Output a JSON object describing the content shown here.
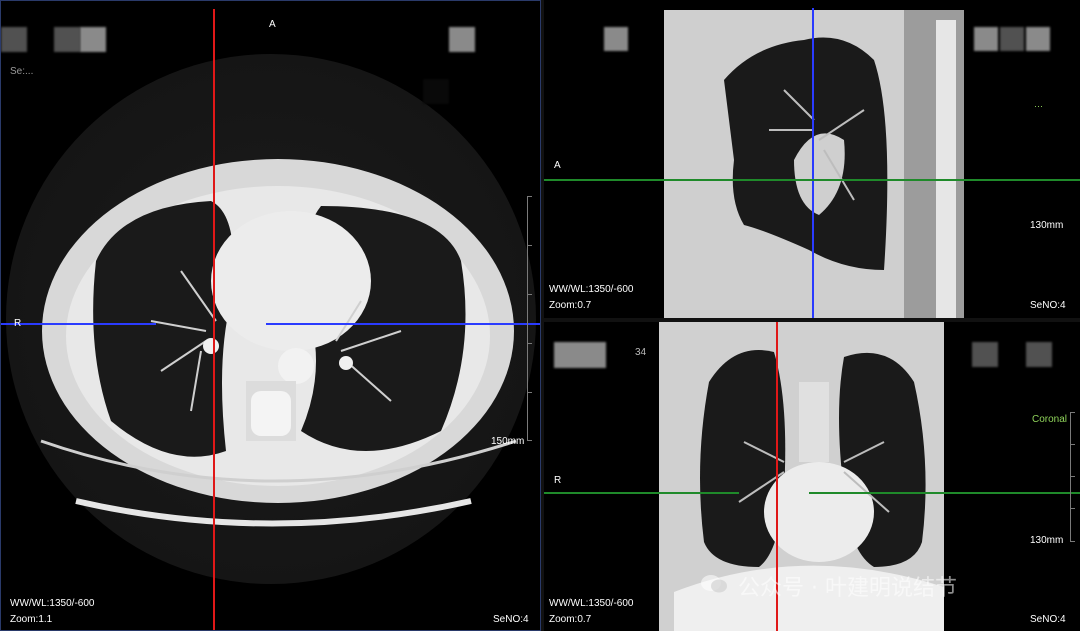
{
  "axial": {
    "orientation_top": "A",
    "orientation_left": "R",
    "window": "WW/WL:1350/-600",
    "zoom": "Zoom:1.1",
    "series": "SeNO:4",
    "scale": "150mm",
    "label_topleft": "Se:..."
  },
  "sagittal": {
    "orientation_left": "A",
    "window": "WW/WL:1350/-600",
    "zoom": "Zoom:0.7",
    "series": "SeNO:4",
    "scale": "130mm"
  },
  "coronal": {
    "orientation_left": "R",
    "window": "WW/WL:1350/-600",
    "zoom": "Zoom:0.7",
    "series": "SeNO:4",
    "scale": "130mm",
    "view_label": "Coronal",
    "number": "34"
  },
  "watermark": "公众号 · 叶建明说结节",
  "colors": {
    "crosshair_red": "#e01818",
    "crosshair_blue": "#2a3bff",
    "crosshair_green": "#1f8a2a",
    "label_green": "#8fd35a"
  }
}
